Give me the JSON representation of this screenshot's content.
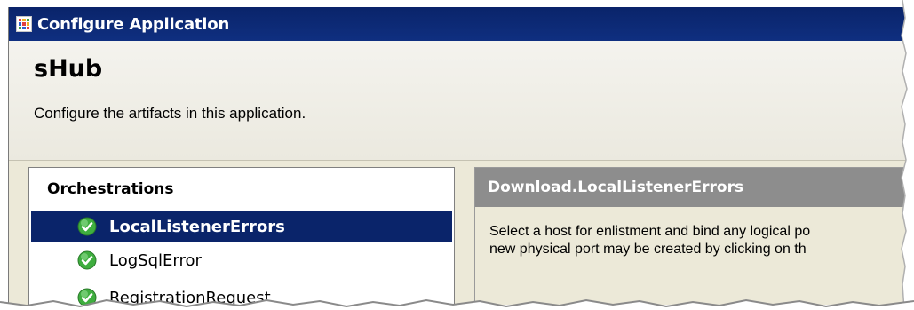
{
  "window": {
    "title": "Configure Application",
    "icon": "application-grid-icon",
    "title_bar_color": "#0a246a"
  },
  "header": {
    "app_name": "sHub",
    "description": "Configure the artifacts in this application."
  },
  "orchestrations": {
    "heading": "Orchestrations",
    "items": [
      {
        "label": "LocalListenerErrors",
        "icon": "green-check-icon",
        "selected": true
      },
      {
        "label": "LogSqlError",
        "icon": "green-check-icon",
        "selected": false
      },
      {
        "label": "RegistrationRequest",
        "icon": "green-check-icon",
        "selected": false
      }
    ],
    "selection_color": "#0a246a"
  },
  "details": {
    "title": "Download.LocalListenerErrors",
    "description_line1": "Select a host for enlistment and bind any logical po",
    "description_line2": "new physical port may be created by clicking on th"
  }
}
